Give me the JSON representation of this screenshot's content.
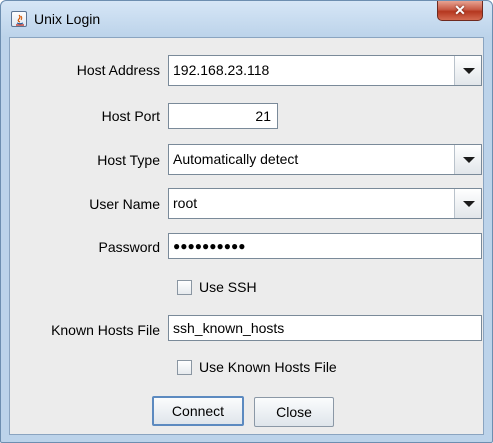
{
  "window": {
    "title": "Unix Login",
    "close_symbol": "✕"
  },
  "icons": {
    "app": "java-app-icon",
    "close": "close-icon",
    "dropdown": "chevron-down-icon"
  },
  "form": {
    "host_address": {
      "label": "Host Address",
      "value": "192.168.23.118"
    },
    "host_port": {
      "label": "Host Port",
      "value": "21"
    },
    "host_type": {
      "label": "Host Type",
      "value": "Automatically detect"
    },
    "user_name": {
      "label": "User Name",
      "value": "root"
    },
    "password": {
      "label": "Password",
      "value": "●●●●●●●●●●"
    },
    "use_ssh": {
      "label": "Use SSH",
      "checked": false
    },
    "known_hosts_file": {
      "label": "Known Hosts File",
      "value": "ssh_known_hosts"
    },
    "use_known_hosts": {
      "label": "Use Known Hosts File",
      "checked": false
    }
  },
  "buttons": {
    "connect": "Connect",
    "close": "Close"
  },
  "colors": {
    "frame": "#bcd3ea",
    "client": "#ececec",
    "close_button": "#c75a45",
    "default_button_border": "#5c8ac0"
  }
}
